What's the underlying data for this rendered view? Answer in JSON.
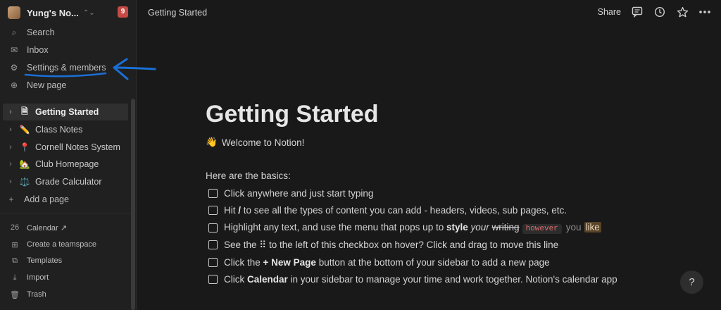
{
  "workspace": {
    "name": "Yung's No...",
    "badge": "9"
  },
  "nav": [
    {
      "label": "Search",
      "icon": "search-icon",
      "glyph": "⌕"
    },
    {
      "label": "Inbox",
      "icon": "inbox-icon",
      "glyph": "✉"
    },
    {
      "label": "Settings & members",
      "icon": "gear-icon",
      "glyph": "⚙"
    },
    {
      "label": "New page",
      "icon": "plus-circle-icon",
      "glyph": "⊕"
    }
  ],
  "pages": [
    {
      "label": "Getting Started",
      "emoji": "🗎",
      "active": true
    },
    {
      "label": "Class Notes",
      "emoji": "✏️"
    },
    {
      "label": "Cornell Notes System",
      "emoji": "📍"
    },
    {
      "label": "Club Homepage",
      "emoji": "🏡"
    },
    {
      "label": "Grade Calculator",
      "emoji": "⚖️"
    }
  ],
  "add_page": "Add a page",
  "bottom_nav": [
    {
      "label": "Calendar ↗",
      "glyph": "26"
    },
    {
      "label": "Create a teamspace",
      "glyph": "⊞"
    },
    {
      "label": "Templates",
      "glyph": "⧉"
    },
    {
      "label": "Import",
      "glyph": "⤓"
    },
    {
      "label": "Trash",
      "glyph": "🗑"
    }
  ],
  "topbar": {
    "breadcrumb": "Getting Started",
    "share": "Share"
  },
  "page": {
    "title": "Getting Started",
    "welcome_emoji": "👋",
    "welcome": "Welcome to Notion!",
    "basics": "Here are the basics:",
    "todos": {
      "t1": "Click anywhere and just start typing",
      "t2a": "Hit ",
      "t2b": "/",
      "t2c": " to see all the types of content you can add - headers, videos, sub pages, etc.",
      "t3a": "Highlight any text, and use the menu that pops up to ",
      "t3b": "style",
      "t3c": "your",
      "t3d": "writing",
      "t3e": "however",
      "t3f": "you",
      "t3g": "like",
      "t4a": "See the ",
      "t4b": "⠿",
      "t4c": " to the left of this checkbox on hover? Click and drag to move this line",
      "t5a": "Click the ",
      "t5b": "+ New Page",
      "t5c": " button at the bottom of your sidebar to add a new page",
      "t6a": "Click ",
      "t6b": "Calendar",
      "t6c": " in your sidebar to manage your time and work together. Notion's calendar app"
    }
  },
  "help": "?",
  "colors": {
    "accent_annotation": "#1a6fd6",
    "badge": "#c54a45",
    "highlight": "#5a4328"
  }
}
